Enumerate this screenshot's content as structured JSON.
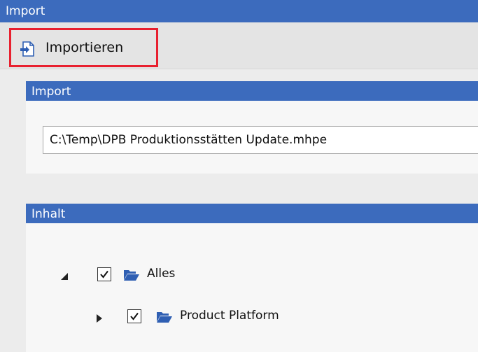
{
  "window": {
    "title": "Import"
  },
  "toolbar": {
    "import_button_label": "Importieren"
  },
  "import_group": {
    "header": "Import",
    "file_path": "C:\\Temp\\DPB Produktionsstätten Update.mhpe"
  },
  "content_group": {
    "header": "Inhalt",
    "tree": [
      {
        "label": "Alles",
        "checked": true,
        "expanded": true
      },
      {
        "label": "Product Platform",
        "checked": true,
        "expanded": false
      }
    ]
  },
  "colors": {
    "header_blue": "#3c6bbd",
    "highlight_red": "#e8202f",
    "folder_blue": "#2f5fb3"
  },
  "icons": {
    "import_button": "import-icon",
    "tree_node": "folder-open-icon",
    "expanded": "triangle-down-icon",
    "collapsed": "triangle-right-icon"
  }
}
